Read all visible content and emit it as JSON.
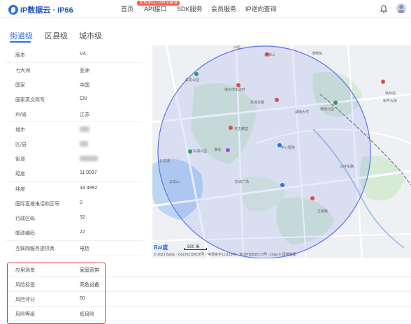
{
  "header": {
    "logo_text": "IP数据云 · IP66",
    "nav": [
      "首页",
      "API接口",
      "SDK服务",
      "会员服务",
      "IP逆向查询"
    ],
    "nav_badge": "免费测试1000次套餐"
  },
  "tabs": [
    "街道级",
    "区县级",
    "城市级"
  ],
  "details": [
    {
      "key": "版本",
      "value": "V4"
    },
    {
      "key": "七大洲",
      "value": "亚洲"
    },
    {
      "key": "国家",
      "value": "中国"
    },
    {
      "key": "国家英文简写",
      "value": "CN"
    },
    {
      "key": "州/省",
      "value": "江苏"
    },
    {
      "key": "城市",
      "value": ""
    },
    {
      "key": "区/县",
      "value": ""
    },
    {
      "key": "街道",
      "value": ""
    },
    {
      "key": "经度",
      "value": "11  0037"
    },
    {
      "key": "纬度",
      "value": "34  4992"
    },
    {
      "key": "国际直拨电话和区号",
      "value": "0"
    },
    {
      "key": "行政区码",
      "value": "32"
    },
    {
      "key": "邮政编码",
      "value": "22  "
    },
    {
      "key": "互联网服务提供商",
      "value": "电信"
    }
  ],
  "bottom_details": [
    {
      "key": "应用场景",
      "value": "家庭宽带"
    },
    {
      "key": "风险标签",
      "value": "高危设备"
    },
    {
      "key": "风险评分",
      "value": "50"
    },
    {
      "key": "风险等级",
      "value": "低风险"
    }
  ],
  "map": {
    "logo": "Bai度",
    "scale": "500 米",
    "copyright": "© 2023 Baidu - GS(2021)6026号 - 甲测资字11111342 - 京ICP证030173号 - Data © 百度智图",
    "labels": [
      "中国",
      "博物院",
      "云龙公园",
      "徐州市市政府",
      "云龙湖",
      "天主教堂",
      "户部山",
      "黄楼公园",
      "东湖公园",
      "淮塔",
      "徐州站",
      "中心医院",
      "三环东路",
      "和平大桥",
      "湖南大学",
      "苏堤北路",
      "彭城广场",
      "王陵路",
      "云龙山"
    ]
  },
  "colors": {
    "accent": "#2f6fe8",
    "highlight": "#e23a3a"
  }
}
